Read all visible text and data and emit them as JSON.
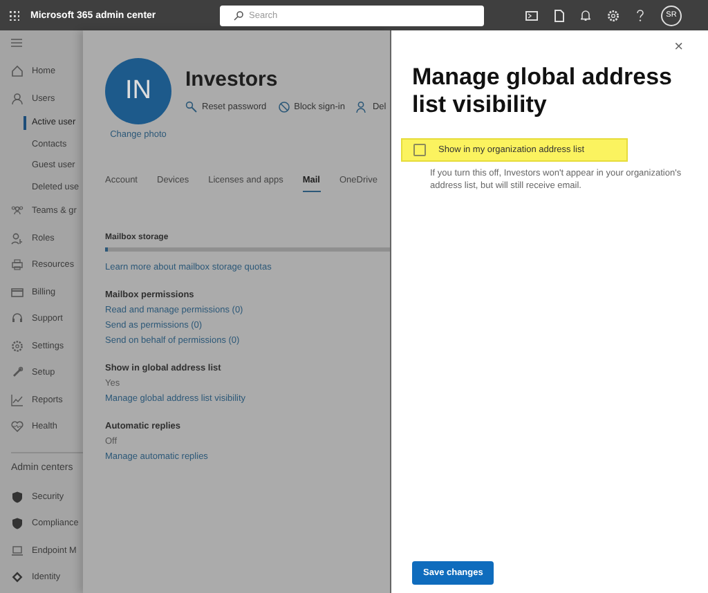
{
  "top_bar": {
    "title": "Microsoft 365 admin center",
    "search": {
      "placeholder": "Search"
    },
    "avatar": "SR"
  },
  "sidebar": {
    "items": [
      {
        "label": "Home",
        "selected": false
      },
      {
        "label": "Users",
        "selected": false,
        "children": [
          {
            "label": "Active user",
            "selected": true
          },
          {
            "label": "Contacts",
            "selected": false
          },
          {
            "label": "Guest user",
            "selected": false
          },
          {
            "label": "Deleted use",
            "selected": false
          }
        ]
      },
      {
        "label": "Teams & gr",
        "selected": false
      },
      {
        "label": "Roles",
        "selected": false
      },
      {
        "label": "Resources",
        "selected": false
      },
      {
        "label": "Billing",
        "selected": false
      },
      {
        "label": "Support",
        "selected": false
      },
      {
        "label": "Settings",
        "selected": false
      },
      {
        "label": "Setup",
        "selected": false
      },
      {
        "label": "Reports",
        "selected": false
      },
      {
        "label": "Health",
        "selected": false
      }
    ],
    "section_label": "Admin centers",
    "admin_items": [
      {
        "label": "Security",
        "selected": false
      },
      {
        "label": "Compliance",
        "selected": false
      },
      {
        "label": "Endpoint M",
        "selected": false
      },
      {
        "label": "Identity",
        "selected": false
      }
    ]
  },
  "user": {
    "initials": "IN",
    "name": "Investors",
    "actions": [
      "Reset password",
      "Block sign-in",
      "Del"
    ],
    "change_photo": "Change photo",
    "tabs": [
      {
        "label": "Account",
        "selected": false
      },
      {
        "label": "Devices",
        "selected": false
      },
      {
        "label": "Licenses and apps",
        "selected": false
      },
      {
        "label": "Mail",
        "selected": true
      },
      {
        "label": "OneDrive",
        "selected": false
      }
    ],
    "mailbox_storage": {
      "heading": "Mailbox storage",
      "level": 0.01,
      "link": "Learn more about mailbox storage quotas"
    },
    "sections": [
      {
        "heading": "Mailbox permissions",
        "links": [
          "Read and manage permissions (0)",
          "Send as permissions (0)",
          "Send on behalf of permissions (0)"
        ]
      },
      {
        "heading": "Show in global address list",
        "value": "Yes",
        "links": [
          "Manage global address list visibility"
        ]
      },
      {
        "heading": "Automatic replies",
        "value": "Off",
        "links": [
          "Manage automatic replies"
        ]
      }
    ]
  },
  "panel": {
    "close": "×",
    "title": "Manage global address list visibility",
    "checkbox": {
      "label": "Show in my organization address list",
      "checked": false,
      "highlighted": true
    },
    "description": "If you turn this off, Investors won't appear in your organization's address list, but will still receive email.",
    "save_button": "Save changes"
  }
}
